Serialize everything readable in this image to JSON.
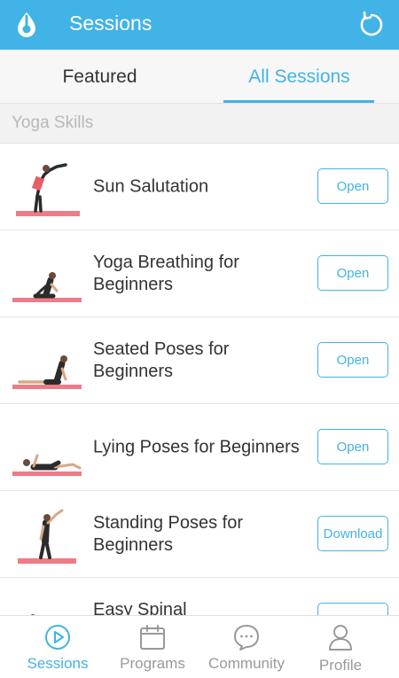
{
  "appbar": {
    "title": "Sessions",
    "logo_icon": "droplet-logo-icon",
    "refresh_icon": "refresh-icon"
  },
  "tabs": [
    {
      "label": "Featured",
      "active": false
    },
    {
      "label": "All Sessions",
      "active": true
    }
  ],
  "section": {
    "title": "Yoga Skills"
  },
  "sessions": [
    {
      "title": "Sun Salutation",
      "button": "Open"
    },
    {
      "title": "Yoga Breathing for Beginners",
      "button": "Open"
    },
    {
      "title": "Seated Poses for Beginners",
      "button": "Open"
    },
    {
      "title": "Lying Poses for Beginners",
      "button": "Open"
    },
    {
      "title": "Standing Poses for Beginners",
      "button": "Download"
    },
    {
      "title": "Easy Spinal",
      "button": ""
    }
  ],
  "nav": [
    {
      "label": "Sessions",
      "icon": "play-circle-icon",
      "active": true
    },
    {
      "label": "Programs",
      "icon": "calendar-icon",
      "active": false
    },
    {
      "label": "Community",
      "icon": "chat-bubble-icon",
      "active": false
    },
    {
      "label": "Profile",
      "icon": "person-icon",
      "active": false
    }
  ],
  "colors": {
    "accent": "#41b3e6",
    "mat": "#ef7b87",
    "text": "#333333",
    "muted": "#999999"
  }
}
